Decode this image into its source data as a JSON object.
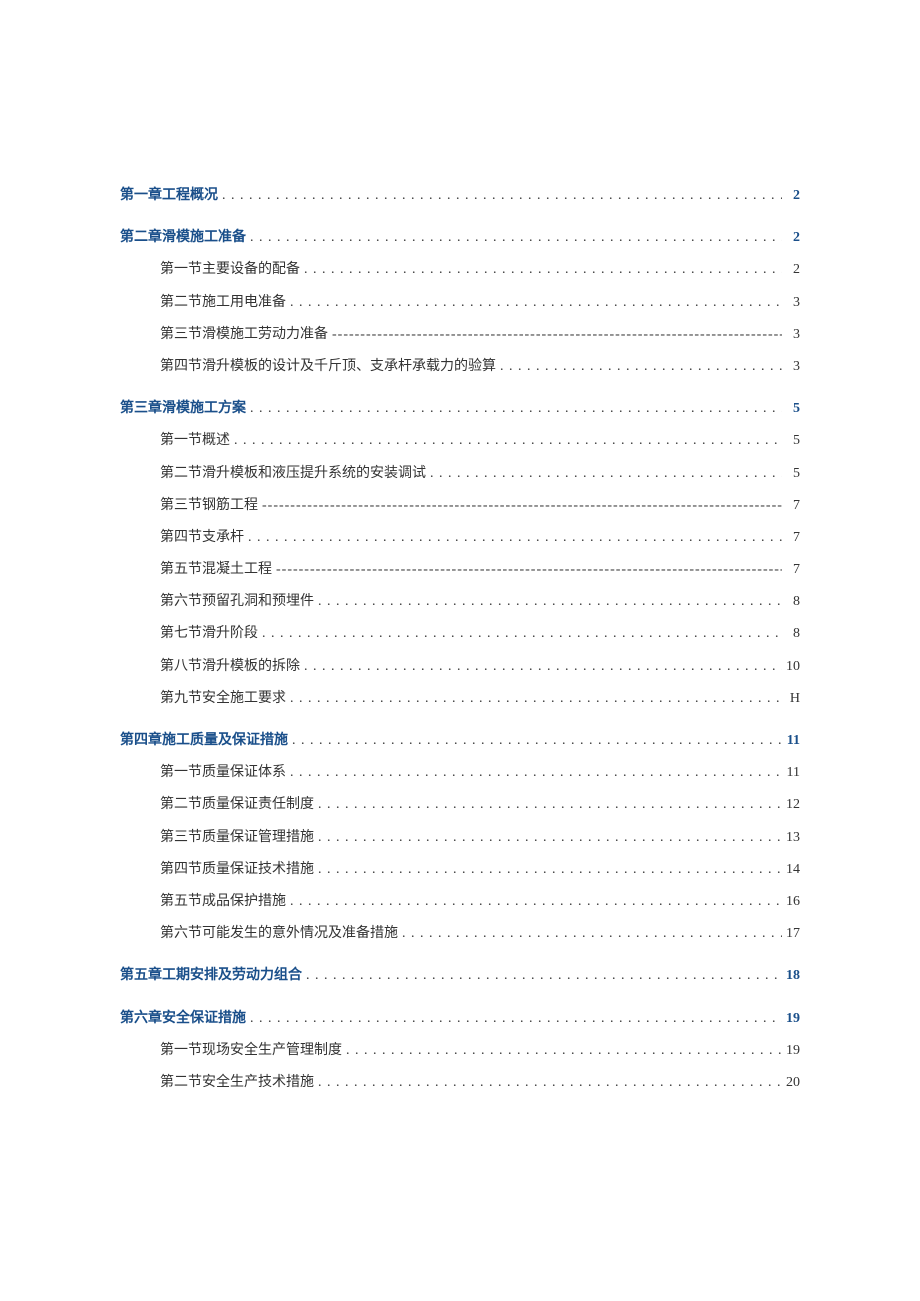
{
  "toc": [
    {
      "level": 1,
      "title": "第一章工程概况",
      "page": "2",
      "leader": "dot"
    },
    {
      "level": 1,
      "title": "第二章滑模施工准备",
      "page": "2",
      "leader": "dot"
    },
    {
      "level": 2,
      "title": "第一节主要设备的配备",
      "page": "2",
      "leader": "dot"
    },
    {
      "level": 2,
      "title": "第二节施工用电准备",
      "page": "3",
      "leader": "dot"
    },
    {
      "level": 2,
      "title": "第三节滑模施工劳动力准备",
      "page": "3",
      "leader": "dash"
    },
    {
      "level": 2,
      "title": "第四节滑升模板的设计及千斤顶、支承杆承载力的验算",
      "page": "3",
      "leader": "dot"
    },
    {
      "level": 1,
      "title": "第三章滑模施工方案",
      "page": "5",
      "leader": "dot"
    },
    {
      "level": 2,
      "title": "第一节概述",
      "page": "5",
      "leader": "dot"
    },
    {
      "level": 2,
      "title": "第二节滑升模板和液压提升系统的安装调试",
      "page": "5",
      "leader": "dot"
    },
    {
      "level": 2,
      "title": "第三节钢筋工程",
      "page": "7",
      "leader": "dash"
    },
    {
      "level": 2,
      "title": "第四节支承杆",
      "page": "7",
      "leader": "dot"
    },
    {
      "level": 2,
      "title": "第五节混凝土工程",
      "page": "7",
      "leader": "dash"
    },
    {
      "level": 2,
      "title": "第六节预留孔洞和预埋件",
      "page": "8",
      "leader": "dot"
    },
    {
      "level": 2,
      "title": "第七节滑升阶段",
      "page": "8",
      "leader": "dot"
    },
    {
      "level": 2,
      "title": "第八节滑升模板的拆除",
      "page": "10",
      "leader": "dot"
    },
    {
      "level": 2,
      "title": "第九节安全施工要求",
      "page": "H",
      "leader": "dot"
    },
    {
      "level": 1,
      "title": "第四章施工质量及保证措施",
      "page": "11",
      "leader": "dot"
    },
    {
      "level": 2,
      "title": "第一节质量保证体系",
      "page": "11",
      "leader": "dot"
    },
    {
      "level": 2,
      "title": "第二节质量保证责任制度",
      "page": "12",
      "leader": "dot"
    },
    {
      "level": 2,
      "title": "第三节质量保证管理措施",
      "page": "13",
      "leader": "dot"
    },
    {
      "level": 2,
      "title": "第四节质量保证技术措施",
      "page": "14",
      "leader": "dot"
    },
    {
      "level": 2,
      "title": "第五节成品保护措施",
      "page": "16",
      "leader": "dot"
    },
    {
      "level": 2,
      "title": "第六节可能发生的意外情况及准备措施",
      "page": "17",
      "leader": "dot"
    },
    {
      "level": 1,
      "title": "第五章工期安排及劳动力组合",
      "page": "18",
      "leader": "dot"
    },
    {
      "level": 1,
      "title": "第六章安全保证措施",
      "page": "19",
      "leader": "dot"
    },
    {
      "level": 2,
      "title": "第一节现场安全生产管理制度",
      "page": "19",
      "leader": "dot"
    },
    {
      "level": 2,
      "title": "第二节安全生产技术措施",
      "page": "20",
      "leader": "dot"
    }
  ],
  "leaders": {
    "dot": ". . . . . . . . . . . . . . . . . . . . . . . . . . . . . . . . . . . . . . . . . . . . . . . . . . . . . . . . . . . . . . . . . . . . . . . . . . . . . . . . . . . . . . . . . . . . . . . . . . . . . . . . . . . . . . . . . . . . . . . . . . . . . . . . . . . . . . . . . . . . . . . . . . . . . . . . . . . . . . . .",
    "dash": "--------------------------------------------------------------------------------------------------------------------------------------------------------------------------"
  }
}
